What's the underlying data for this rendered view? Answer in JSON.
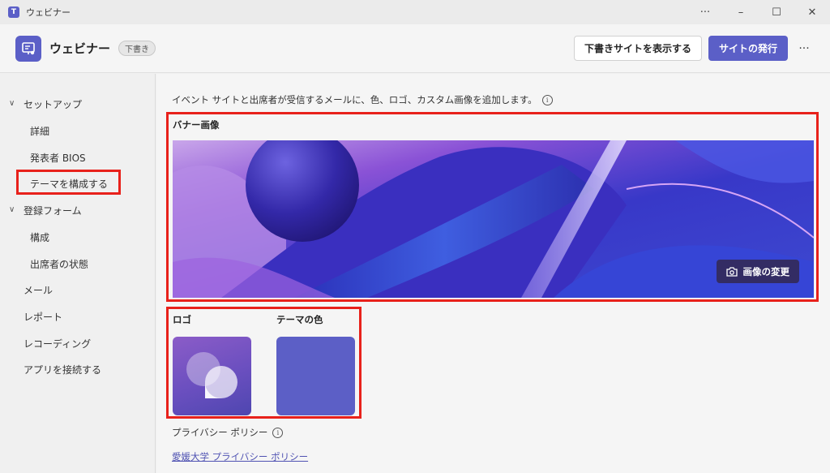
{
  "window": {
    "title": "ウェビナー",
    "controls": {
      "more": "···",
      "minimize": "–",
      "maximize": "☐",
      "close": "✕"
    }
  },
  "header": {
    "title": "ウェビナー",
    "badge": "下書き",
    "view_site_label": "下書きサイトを表示する",
    "publish_label": "サイトの発行",
    "more": "···"
  },
  "sidebar": {
    "items": [
      {
        "label": "セットアップ",
        "chevron": "∨"
      },
      {
        "label": "詳細"
      },
      {
        "label": "発表者 BIOS"
      },
      {
        "label": "テーマを構成する"
      },
      {
        "label": "登録フォーム",
        "chevron": "∨"
      },
      {
        "label": "構成"
      },
      {
        "label": "出席者の状態"
      },
      {
        "label": "メール"
      },
      {
        "label": "レポート"
      },
      {
        "label": "レコーディング"
      },
      {
        "label": "アプリを接続する"
      }
    ]
  },
  "main": {
    "intro": "イベント サイトと出席者が受信するメールに、色、ロゴ、カスタム画像を追加します。",
    "banner_label": "バナー画像",
    "change_image_label": "画像の変更",
    "logo_label": "ロゴ",
    "theme_color_label": "テーマの色",
    "theme_color": "#5c5fc6",
    "privacy_label": "プライバシー ポリシー",
    "privacy_link": "愛媛大学 プライバシー ポリシー"
  },
  "colors": {
    "accent": "#5b5fc7",
    "highlight": "#e8211b"
  }
}
